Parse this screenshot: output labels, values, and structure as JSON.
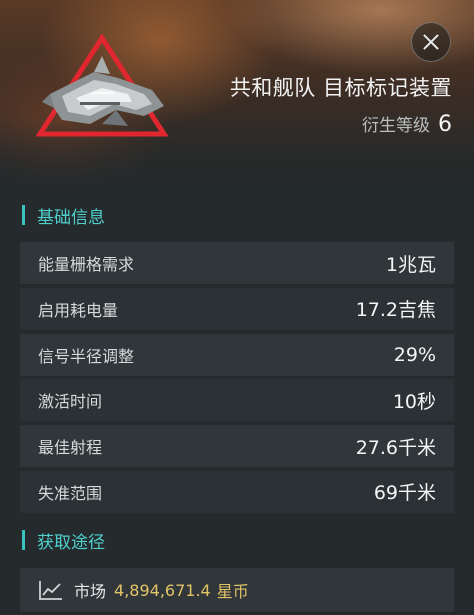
{
  "header": {
    "title": "共和舰队 目标标记装置",
    "meta_level_label": "衍生等级",
    "meta_level_value": "6",
    "icon_name": "target-painter-module-icon",
    "close_icon": "close-icon"
  },
  "sections": {
    "basic_info": "基础信息",
    "acquisition": "获取途径"
  },
  "attributes": [
    {
      "label": "能量栅格需求",
      "value": "1兆瓦"
    },
    {
      "label": "启用耗电量",
      "value": "17.2吉焦"
    },
    {
      "label": "信号半径调整",
      "value": "29%"
    },
    {
      "label": "激活时间",
      "value": "10秒"
    },
    {
      "label": "最佳射程",
      "value": "27.6千米"
    },
    {
      "label": "失准范围",
      "value": "69千米"
    }
  ],
  "market": {
    "label": "市场",
    "price": "4,894,671.4",
    "currency": "星币",
    "icon_name": "chart-line-icon"
  },
  "colors": {
    "accent": "#39c3c0",
    "price": "#e2c467",
    "icon_red": "#e0272f"
  }
}
